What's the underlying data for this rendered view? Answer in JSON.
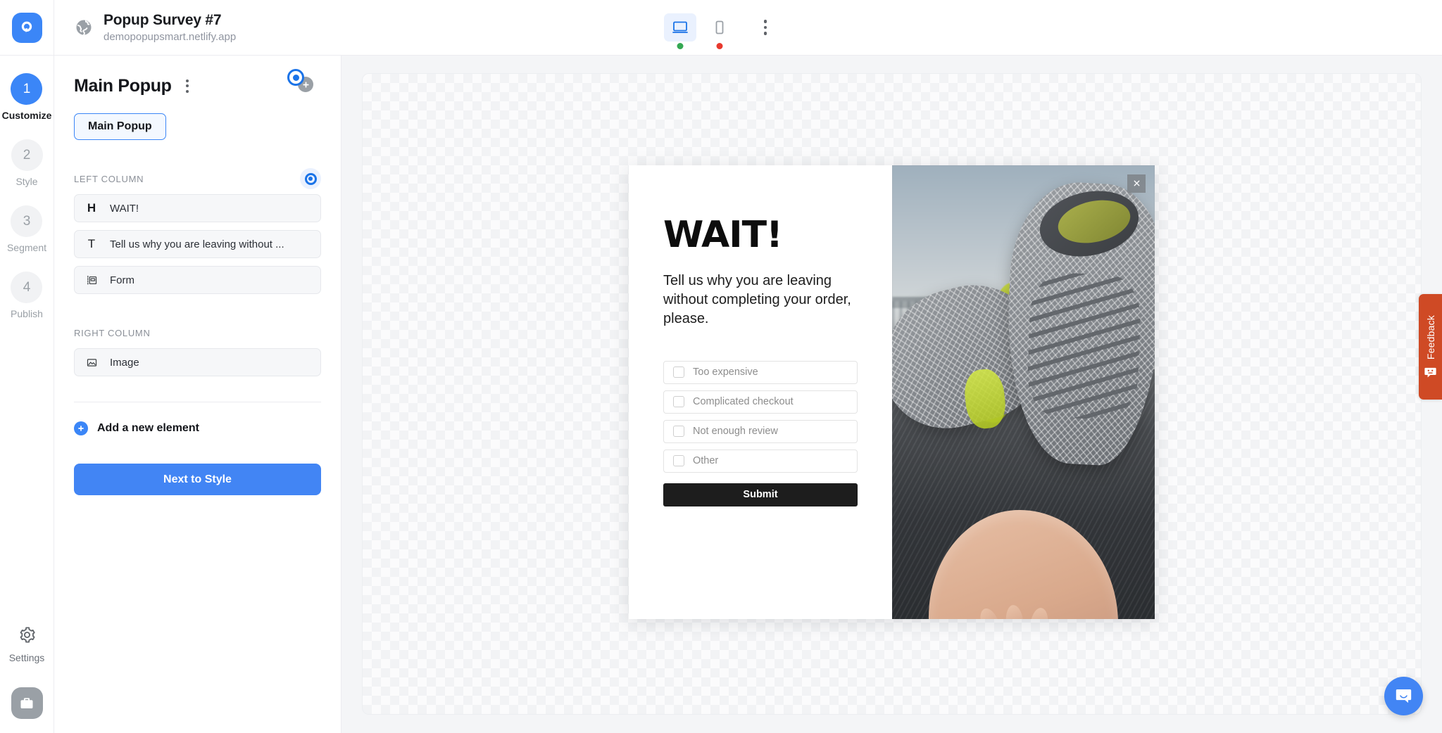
{
  "header": {
    "logo_icon": "popupsmart-logo-icon",
    "globe_icon": "globe-icon",
    "site_title": "Popup Survey #7",
    "site_url": "demopopupsmart.netlify.app",
    "devices": [
      {
        "name": "desktop",
        "icon": "desktop-icon",
        "active": true,
        "status_color": "#34a853"
      },
      {
        "name": "mobile",
        "icon": "mobile-icon",
        "active": false,
        "status_color": "#e8392d"
      }
    ],
    "more_icon": "kebab-menu-icon"
  },
  "rail": {
    "steps": [
      {
        "number": "1",
        "label": "Customize",
        "active": true
      },
      {
        "number": "2",
        "label": "Style",
        "active": false
      },
      {
        "number": "3",
        "label": "Segment",
        "active": false
      },
      {
        "number": "4",
        "label": "Publish",
        "active": false
      }
    ],
    "settings_label": "Settings",
    "settings_icon": "gear-icon",
    "toolbox_icon": "toolbox-icon"
  },
  "panel": {
    "title": "Main Popup",
    "menu_icon": "kebab-menu-icon",
    "target_icon": "target-icon",
    "add_icon": "plus-circle-icon",
    "tab_label": "Main Popup",
    "sections": [
      {
        "label": "LEFT COLUMN",
        "has_target": true,
        "elements": [
          {
            "icon": "heading-icon",
            "glyph": "H",
            "label": "WAIT!"
          },
          {
            "icon": "text-icon",
            "glyph": "T",
            "label": "Tell us why you are leaving without ..."
          },
          {
            "icon": "form-icon",
            "glyph": "",
            "label": "Form"
          }
        ]
      },
      {
        "label": "RIGHT COLUMN",
        "has_target": false,
        "elements": [
          {
            "icon": "image-icon",
            "glyph": "",
            "label": "Image"
          }
        ]
      }
    ],
    "add_element_label": "Add a new element",
    "add_element_icon": "plus-circle-icon",
    "next_button_label": "Next to Style"
  },
  "popup_preview": {
    "heading": "WAIT!",
    "paragraph": "Tell us why you are leaving without completing your order, please.",
    "options": [
      {
        "label": "Too expensive",
        "checked": false
      },
      {
        "label": "Complicated checkout",
        "checked": false
      },
      {
        "label": "Not enough review",
        "checked": false
      },
      {
        "label": "Other",
        "checked": false
      }
    ],
    "submit_label": "Submit",
    "close_icon": "close-icon",
    "image_alt": "gray mesh sneakers tossed above an open hand"
  },
  "feedback": {
    "label": "Feedback",
    "icon": "smiley-chat-icon",
    "color": "#cf4a25"
  },
  "chat": {
    "icon": "chat-bubble-icon",
    "color": "#4285f4"
  }
}
